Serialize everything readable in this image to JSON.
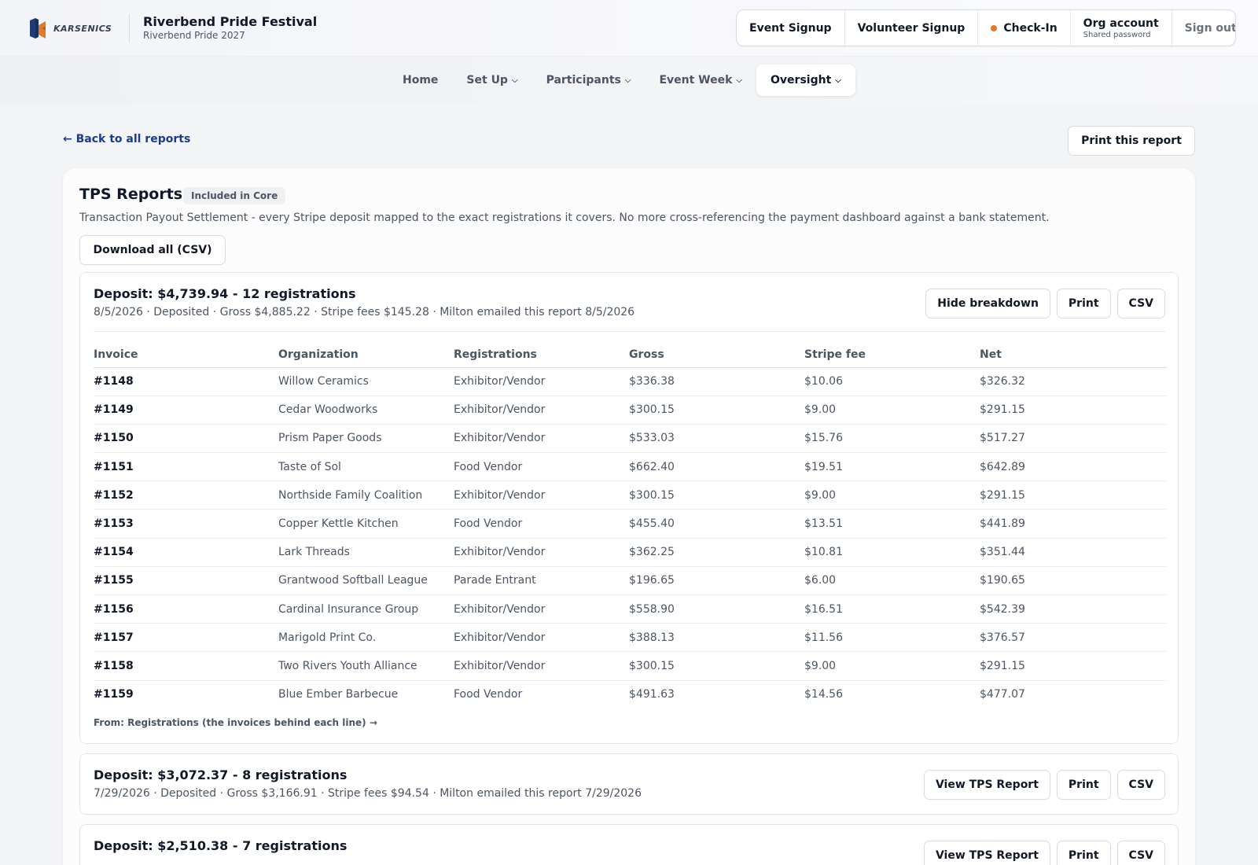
{
  "header": {
    "logo_text": "KARSENICS",
    "title": "Riverbend Pride Festival",
    "subtitle": "Riverbend Pride 2027",
    "actions": {
      "event_signup": "Event Signup",
      "volunteer_signup": "Volunteer Signup",
      "check_in": "Check-In",
      "org_account": "Org account",
      "org_account_sub": "Shared password",
      "sign_out": "Sign out"
    }
  },
  "nav": {
    "home": "Home",
    "set_up": "Set Up",
    "participants": "Participants",
    "event_week": "Event Week",
    "oversight": "Oversight"
  },
  "page": {
    "back_link": "← Back to all reports",
    "print_report": "Print this report",
    "title": "TPS Reports",
    "badge": "Included in Core",
    "description": "Transaction Payout Settlement - every Stripe deposit mapped to the exact registrations it covers. No more cross-referencing the payment dashboard against a bank statement.",
    "download_all": "Download all (CSV)"
  },
  "columns": {
    "invoice": "Invoice",
    "organization": "Organization",
    "registrations": "Registrations",
    "gross": "Gross",
    "stripe_fee": "Stripe fee",
    "net": "Net"
  },
  "deposits": [
    {
      "title": "Deposit: $4,739.94 - 12 registrations",
      "meta": "8/5/2026 · Deposited · Gross $4,885.22 · Stripe fees $145.28 · Milton emailed this report 8/5/2026",
      "toggle_label": "Hide breakdown",
      "print_label": "Print",
      "csv_label": "CSV",
      "footer_link": "From: Registrations (the invoices behind each line) →",
      "rows": [
        {
          "invoice": "#1148",
          "organization": "Willow Ceramics",
          "registrations": "Exhibitor/Vendor",
          "gross": "$336.38",
          "fee": "$10.06",
          "net": "$326.32"
        },
        {
          "invoice": "#1149",
          "organization": "Cedar Woodworks",
          "registrations": "Exhibitor/Vendor",
          "gross": "$300.15",
          "fee": "$9.00",
          "net": "$291.15"
        },
        {
          "invoice": "#1150",
          "organization": "Prism Paper Goods",
          "registrations": "Exhibitor/Vendor",
          "gross": "$533.03",
          "fee": "$15.76",
          "net": "$517.27"
        },
        {
          "invoice": "#1151",
          "organization": "Taste of Sol",
          "registrations": "Food Vendor",
          "gross": "$662.40",
          "fee": "$19.51",
          "net": "$642.89"
        },
        {
          "invoice": "#1152",
          "organization": "Northside Family Coalition",
          "registrations": "Exhibitor/Vendor",
          "gross": "$300.15",
          "fee": "$9.00",
          "net": "$291.15"
        },
        {
          "invoice": "#1153",
          "organization": "Copper Kettle Kitchen",
          "registrations": "Food Vendor",
          "gross": "$455.40",
          "fee": "$13.51",
          "net": "$441.89"
        },
        {
          "invoice": "#1154",
          "organization": "Lark Threads",
          "registrations": "Exhibitor/Vendor",
          "gross": "$362.25",
          "fee": "$10.81",
          "net": "$351.44"
        },
        {
          "invoice": "#1155",
          "organization": "Grantwood Softball League",
          "registrations": "Parade Entrant",
          "gross": "$196.65",
          "fee": "$6.00",
          "net": "$190.65"
        },
        {
          "invoice": "#1156",
          "organization": "Cardinal Insurance Group",
          "registrations": "Exhibitor/Vendor",
          "gross": "$558.90",
          "fee": "$16.51",
          "net": "$542.39"
        },
        {
          "invoice": "#1157",
          "organization": "Marigold Print Co.",
          "registrations": "Exhibitor/Vendor",
          "gross": "$388.13",
          "fee": "$11.56",
          "net": "$376.57"
        },
        {
          "invoice": "#1158",
          "organization": "Two Rivers Youth Alliance",
          "registrations": "Exhibitor/Vendor",
          "gross": "$300.15",
          "fee": "$9.00",
          "net": "$291.15"
        },
        {
          "invoice": "#1159",
          "organization": "Blue Ember Barbecue",
          "registrations": "Food Vendor",
          "gross": "$491.63",
          "fee": "$14.56",
          "net": "$477.07"
        }
      ]
    },
    {
      "title": "Deposit: $3,072.37 - 8 registrations",
      "meta": "7/29/2026 · Deposited · Gross $3,166.91 · Stripe fees $94.54 · Milton emailed this report 7/29/2026",
      "toggle_label": "View TPS Report",
      "print_label": "Print",
      "csv_label": "CSV"
    },
    {
      "title": "Deposit: $2,510.38 - 7 registrations",
      "toggle_label": "View TPS Report",
      "print_label": "Print",
      "csv_label": "CSV"
    }
  ],
  "colors": {
    "accent_dot": "#e07a28",
    "link": "#1e3a8a"
  }
}
